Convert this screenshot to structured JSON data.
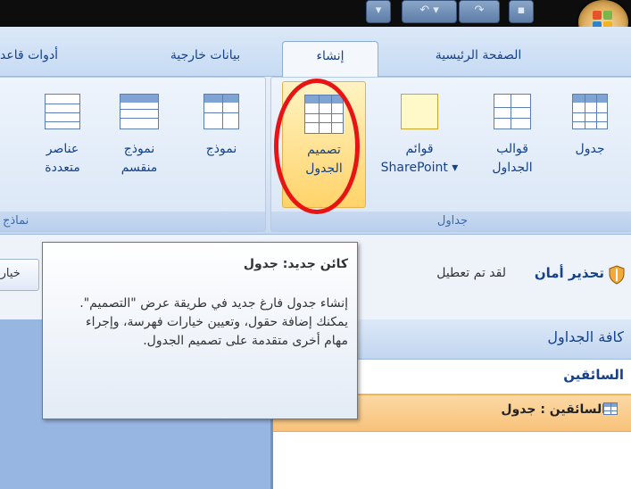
{
  "tabs": [
    "الصفحة الرئيسية",
    "إنشاء",
    "بيانات خارجية",
    "أدوات قاعد"
  ],
  "active_tab": "إنشاء",
  "groups": {
    "tables": {
      "label": "جداول",
      "buttons": [
        "جدول",
        "قوالب\nالجداول",
        "قوائم\nSharePoint ▾",
        "تصميم\nالجدول"
      ]
    },
    "forms": {
      "label": "نماذج",
      "buttons": [
        "نموذج",
        "نموذج\nمنقسم",
        "عناصر\nمتعددة"
      ]
    }
  },
  "security": {
    "title": "تحذير أمان",
    "message": "لقد تم تعطيل",
    "options": "خيارا"
  },
  "tooltip": {
    "title": "كائن جديد: جدول",
    "body": "إنشاء جدول فارغ جديد في طريقة عرض \"التصميم\". يمكنك إضافة حقول، وتعيين خيارات فهرسة، وإجراء مهام أخرى متقدمة على تصميم الجدول."
  },
  "nav": {
    "header": "كافة الجداول",
    "group": "السائقين",
    "item": "السائقين : جدول"
  },
  "colors": {
    "ribbon_text": "#15428b",
    "highlight": "#ffd36a",
    "annotation": "#e81414",
    "left_pane": "#98b6e2",
    "selected_item": "#f8c27a"
  }
}
